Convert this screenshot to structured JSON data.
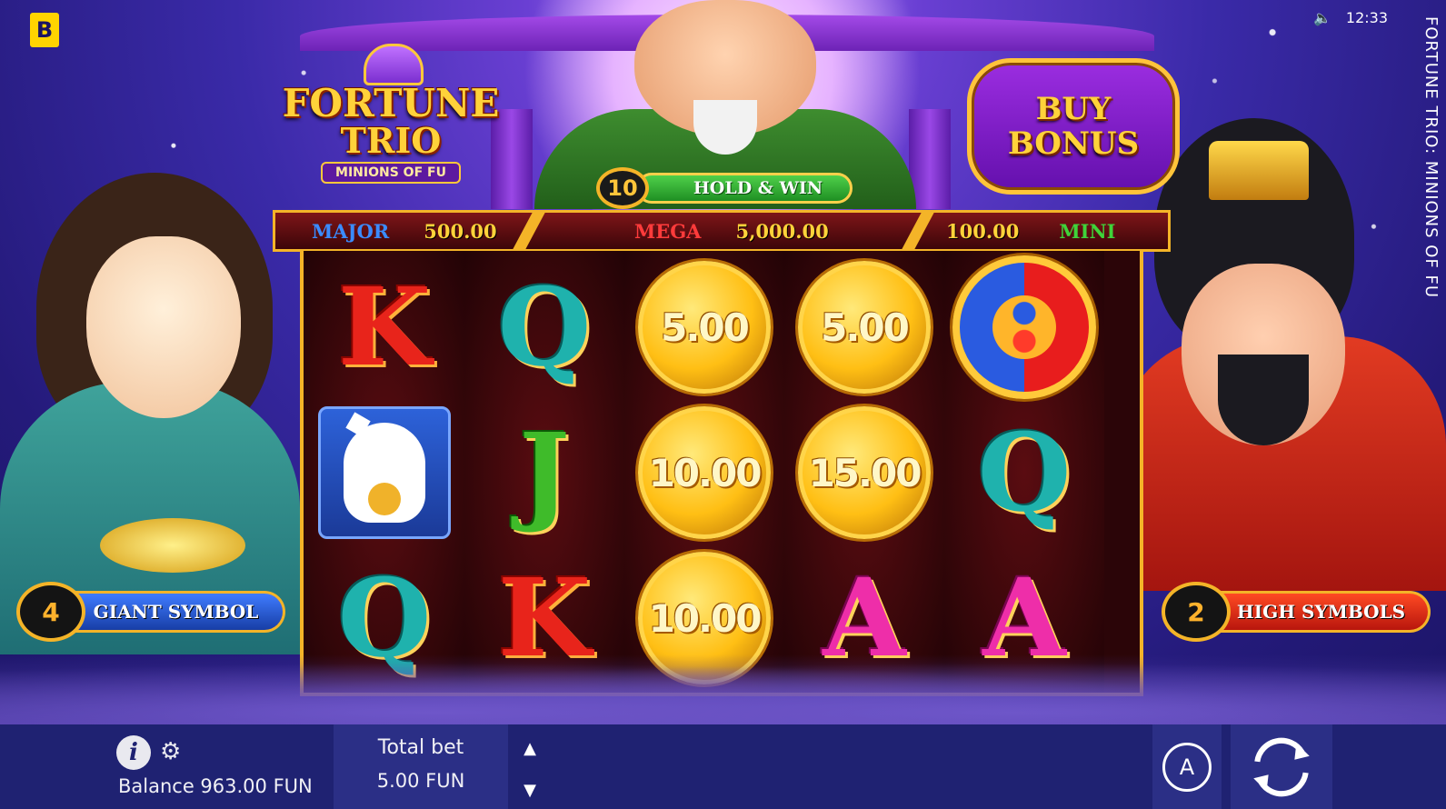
{
  "brand": {
    "logo_letter": "B"
  },
  "status": {
    "time": "12:33",
    "volume_icon": "speaker-icon"
  },
  "side_title": "FORTUNE TRIO: MINIONS OF FU",
  "game_logo": {
    "line1": "FORTUNE",
    "line2": "TRIO",
    "line3": "MINIONS OF FU"
  },
  "buy_bonus": {
    "line1": "BUY",
    "line2": "BONUS"
  },
  "hold_and_win": {
    "count": "10",
    "label": "HOLD & WIN"
  },
  "jackpots": {
    "major": {
      "label": "MAJOR",
      "value": "500.00",
      "color": "#3a8cff"
    },
    "mega": {
      "label": "MEGA",
      "value": "5,000.00",
      "color": "#ff3b3b"
    },
    "mini": {
      "label": "MINI",
      "value": "100.00",
      "color": "#3fd43a"
    }
  },
  "reels": [
    [
      {
        "type": "letter",
        "value": "K"
      },
      {
        "type": "cat",
        "value": "lucky-cat-icon"
      },
      {
        "type": "letter",
        "value": "Q"
      }
    ],
    [
      {
        "type": "letter",
        "value": "Q"
      },
      {
        "type": "letter",
        "value": "J"
      },
      {
        "type": "letter",
        "value": "K"
      }
    ],
    [
      {
        "type": "coin",
        "value": "5.00"
      },
      {
        "type": "coin",
        "value": "10.00"
      },
      {
        "type": "coin",
        "value": "10.00"
      }
    ],
    [
      {
        "type": "coin",
        "value": "5.00"
      },
      {
        "type": "coin",
        "value": "15.00"
      },
      {
        "type": "letter",
        "value": "A"
      }
    ],
    [
      {
        "type": "yinyang",
        "value": "yin-yang-icon"
      },
      {
        "type": "letter",
        "value": "Q"
      },
      {
        "type": "letter",
        "value": "A"
      }
    ]
  ],
  "badges": {
    "giant": {
      "count": "4",
      "label": "GIANT SYMBOL"
    },
    "high": {
      "count": "2",
      "label": "HIGH SYMBOLS"
    }
  },
  "bottom": {
    "balance": "Balance 963.00 FUN",
    "total_bet_label": "Total bet",
    "total_bet_value": "5.00 FUN",
    "autoplay_label": "A"
  }
}
